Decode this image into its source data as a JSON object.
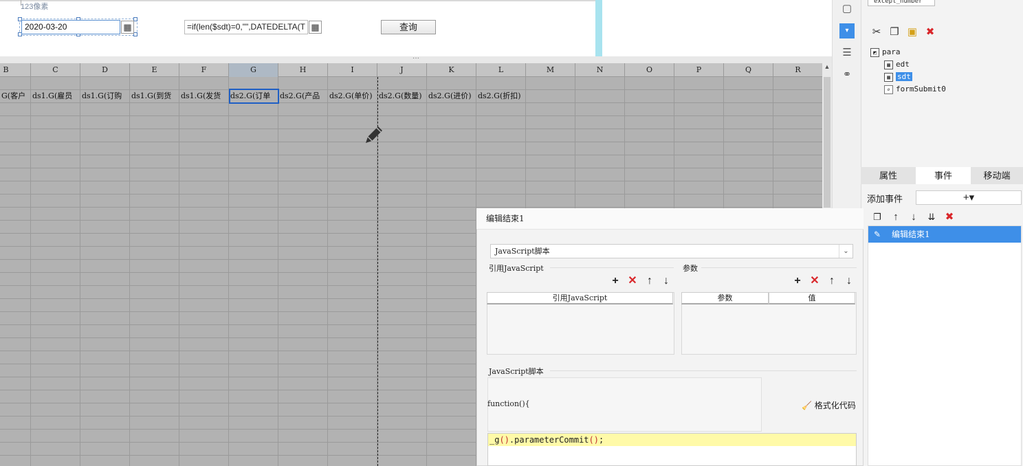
{
  "param_pane": {
    "size_label": "123像素",
    "date_value": "2020-03-20",
    "formula_value": "=if(len($sdt)=0,\"\",DATEDELTA(T",
    "query_label": "查询"
  },
  "splitter_label": "···",
  "sheet": {
    "columns": [
      "B",
      "C",
      "D",
      "E",
      "F",
      "G",
      "H",
      "I",
      "J",
      "K",
      "L",
      "M",
      "N",
      "O",
      "P",
      "Q",
      "R"
    ],
    "selected_column": "G",
    "row1_cells": [
      "G(客户",
      "ds1.G(雇员",
      "ds1.G(订购",
      "ds1.G(到货",
      "ds1.G(发货",
      "ds2.G(订单",
      "ds2.G(产品",
      "ds2.G(单价)",
      "ds2.G(数量)",
      "ds2.G(进价)",
      "ds2.G(折扣)"
    ]
  },
  "right_panel": {
    "widget_name": "except_number",
    "tree": {
      "root": "para",
      "children": [
        "edt",
        "sdt",
        "formSubmit0"
      ],
      "selected": "sdt"
    },
    "tabs": [
      "属性",
      "事件",
      "移动端"
    ],
    "active_tab": "事件",
    "add_event_label": "添加事件",
    "add_event_button": "+▾",
    "event_items": [
      "编辑结束1"
    ]
  },
  "dialog": {
    "title": "编辑结束1",
    "script_type": "JavaScript脚本",
    "ref_js_section": "引用JavaScript",
    "params_section": "参数",
    "ref_js_column": "引用JavaScript",
    "param_column": "参数",
    "value_column": "值",
    "script_section": "JavaScript脚本",
    "function_header": "function(){",
    "format_code_label": "格式化代码",
    "code_line": "_g().parameterCommit();"
  },
  "colors": {
    "accent": "#3e8fe8",
    "delete_red": "#d9262a",
    "sheet_gray": "#b2b2b2",
    "highlight_yellow": "#fffaa8"
  }
}
